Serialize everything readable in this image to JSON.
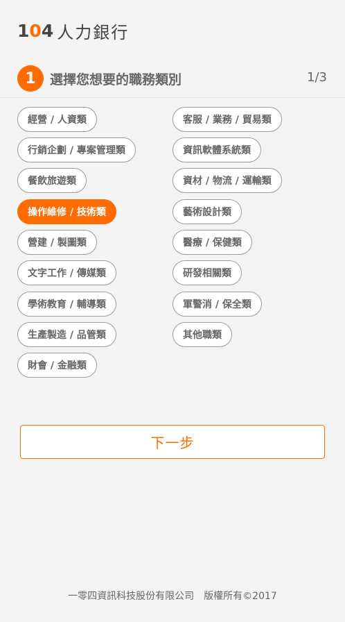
{
  "header": {
    "logo_num_left": "1",
    "logo_num_zero": "0",
    "logo_num_right": "4",
    "logo_text": "人力銀行"
  },
  "step": {
    "number": "1",
    "title": "選擇您想要的職務類別",
    "progress": "1/3"
  },
  "categories": {
    "left": [
      {
        "label": "經營 / 人資類",
        "selected": false
      },
      {
        "label": "行銷企劃 / 專案管理類",
        "selected": false
      },
      {
        "label": "餐飲旅遊類",
        "selected": false
      },
      {
        "label": "操作維修 / 技術類",
        "selected": true
      },
      {
        "label": "營建 / 製圖類",
        "selected": false
      },
      {
        "label": "文字工作 / 傳媒類",
        "selected": false
      },
      {
        "label": "學術教育 / 輔導類",
        "selected": false
      },
      {
        "label": "生產製造 / 品管類",
        "selected": false
      },
      {
        "label": "財會 / 金融類",
        "selected": false
      }
    ],
    "right": [
      {
        "label": "客服 / 業務 / 貿易類",
        "selected": false
      },
      {
        "label": "資訊軟體系統類",
        "selected": false
      },
      {
        "label": "資材 / 物流 / 運輸類",
        "selected": false
      },
      {
        "label": "藝術設計類",
        "selected": false
      },
      {
        "label": "醫療 / 保健類",
        "selected": false
      },
      {
        "label": "研發相關類",
        "selected": false
      },
      {
        "label": "軍警消 / 保全類",
        "selected": false
      },
      {
        "label": "其他職類",
        "selected": false
      }
    ]
  },
  "actions": {
    "next_label": "下一步"
  },
  "footer": {
    "text": "一零四資訊科技股份有限公司　版權所有©2017"
  },
  "colors": {
    "accent": "#ff6b00",
    "background": "#f4f4f4",
    "chip_border": "#9a9a9a"
  }
}
